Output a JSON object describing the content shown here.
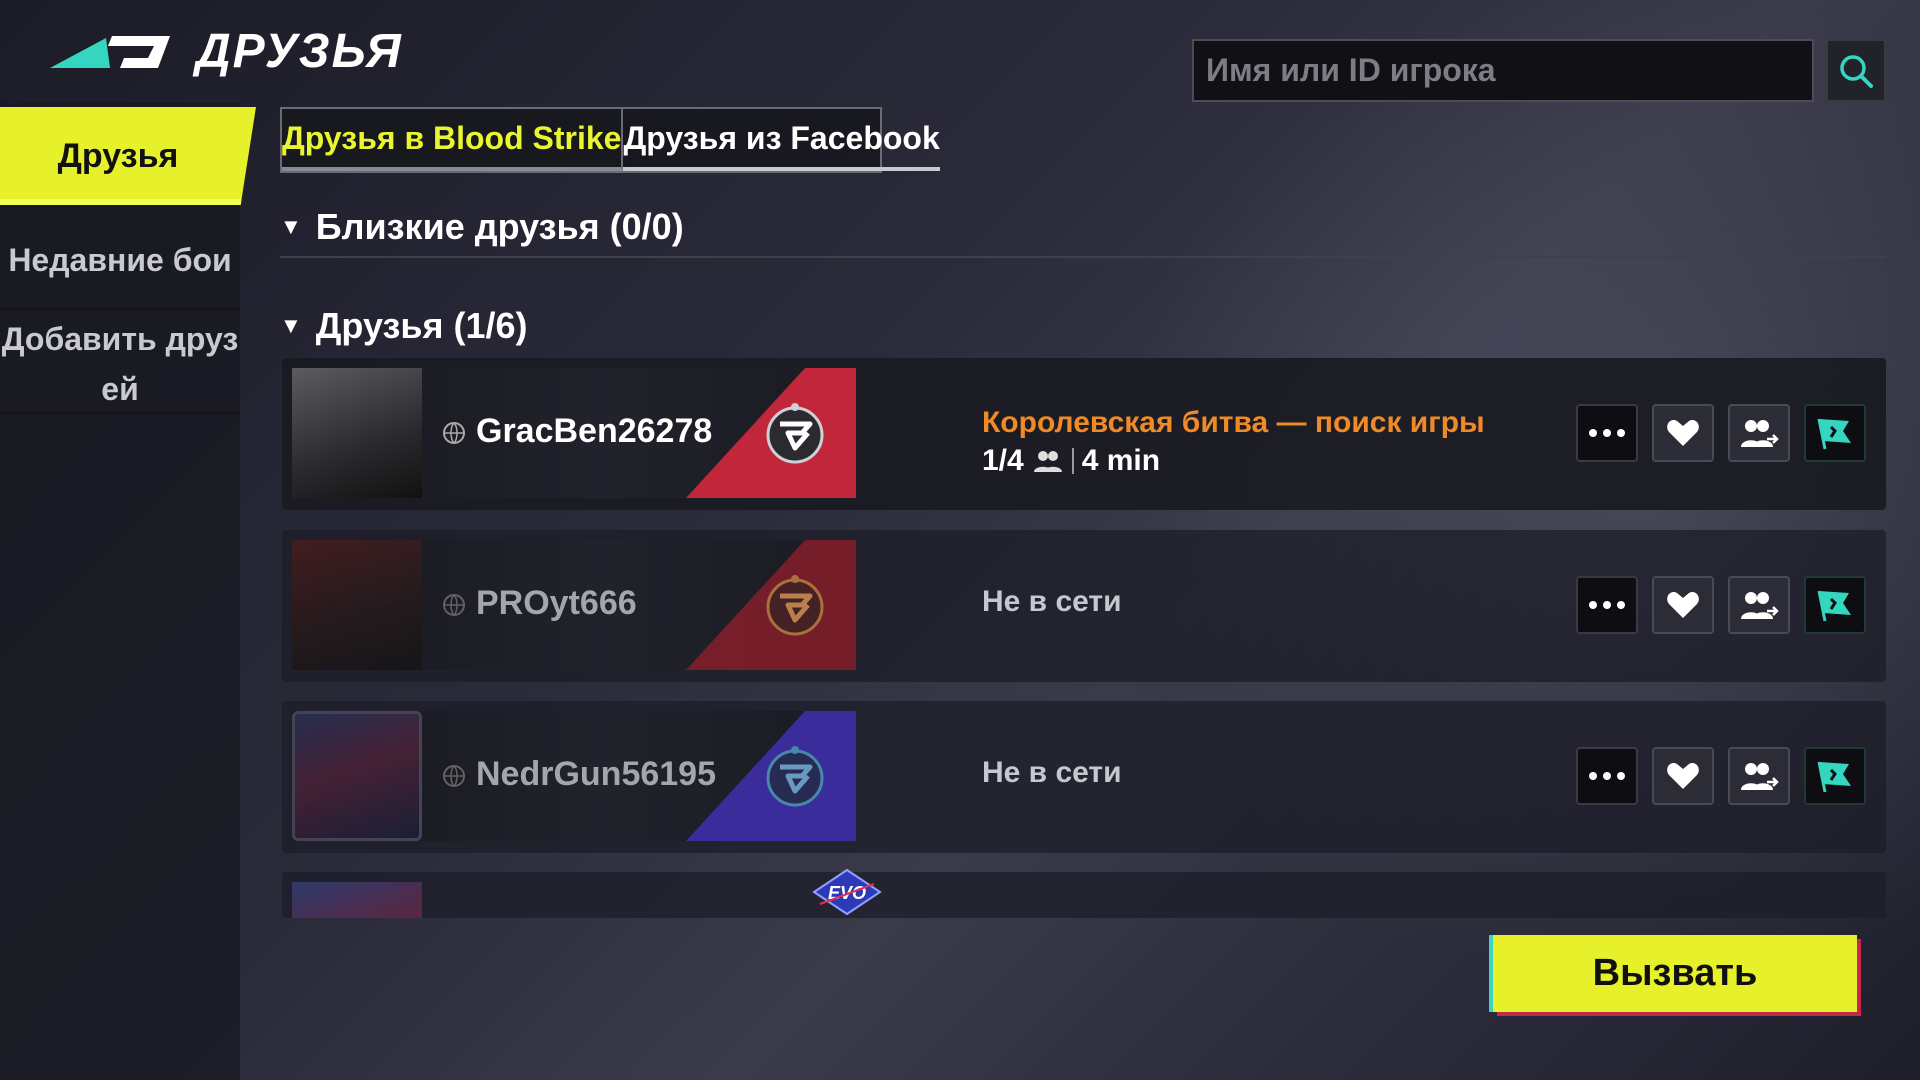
{
  "header": {
    "title": "ДРУЗЬЯ",
    "logo_icon": "blood-strike-logo",
    "search": {
      "placeholder": "Имя или ID игрока",
      "value": "",
      "icon": "search-icon"
    }
  },
  "sidebar": {
    "items": [
      {
        "label": "Друзья",
        "active": true
      },
      {
        "label": "Недавние бои",
        "active": false
      },
      {
        "label": "Добавить друз ей",
        "active": false
      }
    ]
  },
  "tabs": [
    {
      "label": "Друзья в Blood Strike",
      "active": true
    },
    {
      "label": "Друзья из Facebook",
      "active": false
    }
  ],
  "sections": {
    "close_friends": "Близкие друзья (0/0)",
    "friends": "Друзья (1/6)"
  },
  "friends": [
    {
      "name": "GracBen26278",
      "status": "Королевская битва — поиск игры",
      "party": "1/4",
      "time": "4 min",
      "online": true
    },
    {
      "name": "PROyt666",
      "status": "Не в сети",
      "online": false
    },
    {
      "name": "NedrGun56195",
      "status": "Не в сети",
      "online": false
    }
  ],
  "colors": {
    "accent": "#e6f12b",
    "status_online": "#f08a26",
    "teal": "#35d6c0",
    "stripe_red": "#c2263a",
    "stripe_blue": "#3a2c9a"
  },
  "call_button": "Вызвать"
}
